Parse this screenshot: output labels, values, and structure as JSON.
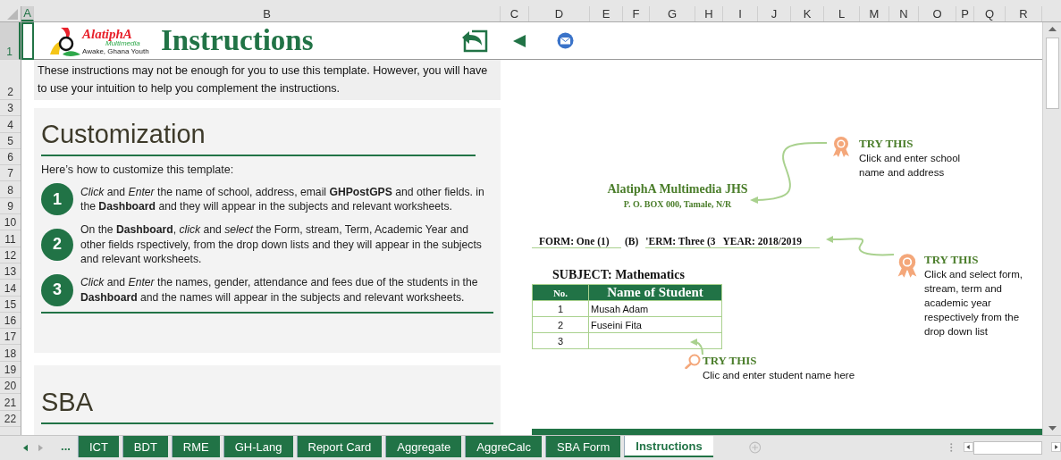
{
  "columns": [
    {
      "label": "A",
      "selected": true
    },
    {
      "label": "B",
      "selected": false
    },
    {
      "label": "C",
      "selected": false
    },
    {
      "label": "D",
      "selected": false
    },
    {
      "label": "E",
      "selected": false
    },
    {
      "label": "F",
      "selected": false
    },
    {
      "label": "G",
      "selected": false
    },
    {
      "label": "H",
      "selected": false
    },
    {
      "label": "I",
      "selected": false
    },
    {
      "label": "J",
      "selected": false
    },
    {
      "label": "K",
      "selected": false
    },
    {
      "label": "L",
      "selected": false
    },
    {
      "label": "M",
      "selected": false
    },
    {
      "label": "N",
      "selected": false
    },
    {
      "label": "O",
      "selected": false
    },
    {
      "label": "P",
      "selected": false
    },
    {
      "label": "Q",
      "selected": false
    },
    {
      "label": "R",
      "selected": false
    }
  ],
  "rows": [
    {
      "label": "1",
      "selected": true
    },
    {
      "label": "2",
      "selected": false
    },
    {
      "label": "3",
      "selected": false
    },
    {
      "label": "4",
      "selected": false
    },
    {
      "label": "5",
      "selected": false
    },
    {
      "label": "6",
      "selected": false
    },
    {
      "label": "7",
      "selected": false
    },
    {
      "label": "8",
      "selected": false
    },
    {
      "label": "9",
      "selected": false
    },
    {
      "label": "10",
      "selected": false
    },
    {
      "label": "11",
      "selected": false
    },
    {
      "label": "12",
      "selected": false
    },
    {
      "label": "13",
      "selected": false
    },
    {
      "label": "14",
      "selected": false
    },
    {
      "label": "15",
      "selected": false
    },
    {
      "label": "16",
      "selected": false
    },
    {
      "label": "17",
      "selected": false
    },
    {
      "label": "18",
      "selected": false
    },
    {
      "label": "19",
      "selected": false
    },
    {
      "label": "20",
      "selected": false
    },
    {
      "label": "21",
      "selected": false
    },
    {
      "label": "22",
      "selected": false
    }
  ],
  "header": {
    "logo_text": "AlatiphA",
    "logo_sub": "Multimedia",
    "logo_tagline": "Awake, Ghana Youth",
    "title": "Instructions"
  },
  "intro": "These instructions may not be enough for you to use this template. However, you will have to use your intuition to help you complement the instructions.",
  "customization": {
    "heading": "Customization",
    "lead": "Here’s how to customize this template:",
    "steps": [
      {
        "number": "1",
        "text": "*Click* and *Enter* the name of school, address, email **GHPostGPS** and other fields. in the **Dashboard** and they will appear in the subjects and relevant worksheets."
      },
      {
        "number": "2",
        "text": "On the **Dashboard**, *click* and *select* the Form, stream, Term,  Academic Year and other fields rspectively, from the drop down lists and they will appear in the subjects and relevant worksheets."
      },
      {
        "number": "3",
        "text": "*Click* and *Enter* the names, gender, attendance and fees due  of the students in the **Dashboard** and the names will appear in the subjects and relevant worksheets."
      }
    ]
  },
  "sba": {
    "heading": "SBA"
  },
  "school": {
    "name": "AlatiphA Multimedia JHS",
    "address": "P. O. BOX 000, Tamale, N/R"
  },
  "form_line": {
    "form": "FORM: One (1)",
    "stream": "(B)",
    "term": "'ERM: Three (3",
    "year": "YEAR: 2018/2019"
  },
  "subject": "SUBJECT: Mathematics",
  "student_table": {
    "columns": [
      "No.",
      "Name of Student"
    ],
    "rows": [
      {
        "no": "1",
        "name": "Musah Adam"
      },
      {
        "no": "2",
        "name": "Fuseini Fita"
      },
      {
        "no": "3"
      }
    ]
  },
  "tips": [
    {
      "kind": "ribbon",
      "title": "TRY THIS",
      "text": "Click and enter school name and address"
    },
    {
      "kind": "ribbon",
      "title": "TRY THIS",
      "text": "Click and select form, stream, term and academic year respectively from the drop down list"
    },
    {
      "kind": "search",
      "title": "TRY THIS",
      "text": "Clic and enter student name here"
    }
  ],
  "tab_overflow": "...",
  "tabs": [
    {
      "label": "ICT",
      "selected": false
    },
    {
      "label": "BDT",
      "selected": false
    },
    {
      "label": "RME",
      "selected": false
    },
    {
      "label": "GH-Lang",
      "selected": false
    },
    {
      "label": "Report Card",
      "selected": false
    },
    {
      "label": "Aggregate",
      "selected": false
    },
    {
      "label": "AggreCalc",
      "selected": false
    },
    {
      "label": "SBA Form",
      "selected": false
    },
    {
      "label": "Instructions",
      "selected": true
    }
  ]
}
